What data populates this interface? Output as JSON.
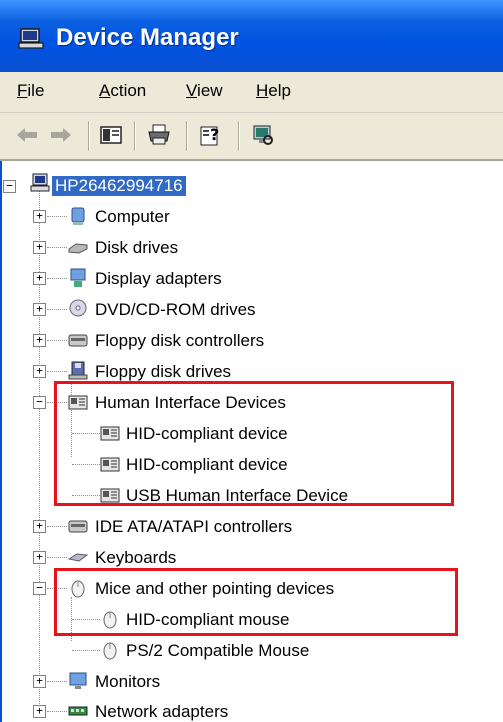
{
  "window": {
    "title": "Device Manager"
  },
  "menu": [
    {
      "label": "File",
      "u": "F",
      "rest": "ile"
    },
    {
      "label": "Action",
      "u": "A",
      "rest": "ction"
    },
    {
      "label": "View",
      "u": "V",
      "rest": "iew"
    },
    {
      "label": "Help",
      "u": "H",
      "rest": "elp"
    }
  ],
  "toolbar": {
    "buttons": [
      "back-icon",
      "forward-icon",
      "show-hide-tree-icon",
      "print-icon",
      "properties-help-icon",
      "scan-hardware-icon"
    ]
  },
  "tree": {
    "root": "HP26462994716",
    "items": [
      {
        "label": "Computer",
        "icon": "computer-icon",
        "expanded": false
      },
      {
        "label": "Disk drives",
        "icon": "disk-drive-icon",
        "expanded": false
      },
      {
        "label": "Display adapters",
        "icon": "display-adapter-icon",
        "expanded": false
      },
      {
        "label": "DVD/CD-ROM drives",
        "icon": "cd-drive-icon",
        "expanded": false
      },
      {
        "label": "Floppy disk controllers",
        "icon": "controller-icon",
        "expanded": false
      },
      {
        "label": "Floppy disk drives",
        "icon": "floppy-icon",
        "expanded": false
      },
      {
        "label": "Human Interface Devices",
        "icon": "hid-icon",
        "expanded": true
      },
      {
        "label": "HID-compliant device",
        "icon": "hid-icon",
        "child": true
      },
      {
        "label": "HID-compliant device",
        "icon": "hid-icon",
        "child": true
      },
      {
        "label": "USB Human Interface Device",
        "icon": "hid-icon",
        "child": true
      },
      {
        "label": "IDE ATA/ATAPI controllers",
        "icon": "controller-icon",
        "expanded": false
      },
      {
        "label": "Keyboards",
        "icon": "keyboard-icon",
        "expanded": false
      },
      {
        "label": "Mice and other pointing devices",
        "icon": "mouse-icon",
        "expanded": true
      },
      {
        "label": "HID-compliant mouse",
        "icon": "mouse-icon",
        "child": true
      },
      {
        "label": "PS/2 Compatible Mouse",
        "icon": "mouse-icon",
        "child": true
      },
      {
        "label": "Monitors",
        "icon": "monitor-icon",
        "expanded": false
      },
      {
        "label": "Network adapters",
        "icon": "network-icon",
        "expanded": false
      }
    ]
  },
  "colors": {
    "titlebar": "#0054e3",
    "selection": "#316ac5",
    "highlight_box": "#e8131a",
    "chrome": "#ece9d8"
  }
}
